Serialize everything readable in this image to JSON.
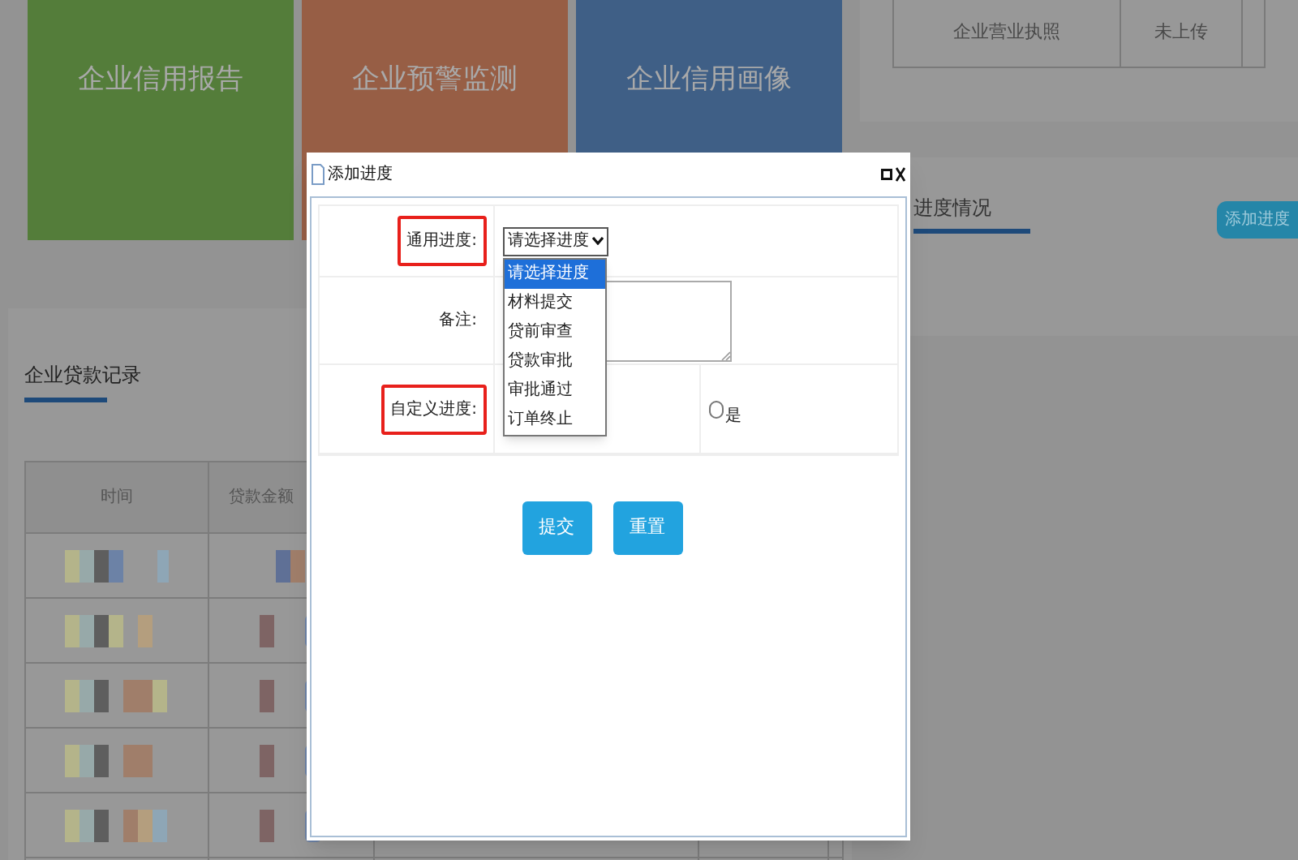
{
  "cards": [
    {
      "title": "企业信用报告",
      "color": "#547d3a"
    },
    {
      "title": "企业预警监测",
      "color": "#975e45"
    },
    {
      "title": "企业信用画像",
      "color": "#3f5f86"
    }
  ],
  "document_table": {
    "rows": [
      [
        "企业营业执照",
        "未上传"
      ]
    ]
  },
  "progress_panel": {
    "title": "进度情况",
    "button": "添加进度"
  },
  "loan_records": {
    "title": "企业贷款记录",
    "columns": [
      "时间",
      "贷款金额"
    ],
    "rows": [
      {
        "kind": "redacted"
      },
      {
        "kind": "redacted"
      },
      {
        "kind": "redacted"
      },
      {
        "kind": "redacted"
      },
      {
        "kind": "redacted"
      }
    ]
  },
  "dialog": {
    "title": "添加进度",
    "fields": [
      {
        "kind": "select",
        "label": "通用进度:",
        "highlighted": true,
        "value": "请选择进度",
        "expanded": true,
        "options": [
          {
            "label": "请选择进度",
            "selected": true
          },
          {
            "label": "材料提交",
            "selected": false
          },
          {
            "label": "贷前审查",
            "selected": false
          },
          {
            "label": "贷款审批",
            "selected": false
          },
          {
            "label": "审批通过",
            "selected": false
          },
          {
            "label": "订单终止",
            "selected": false
          }
        ]
      },
      {
        "kind": "textarea",
        "label": "备注:",
        "highlighted": false
      },
      {
        "kind": "radio",
        "label": "自定义进度:",
        "highlighted": true,
        "option": "是",
        "checked": false
      }
    ],
    "buttons": [
      "提交",
      "重置"
    ]
  }
}
